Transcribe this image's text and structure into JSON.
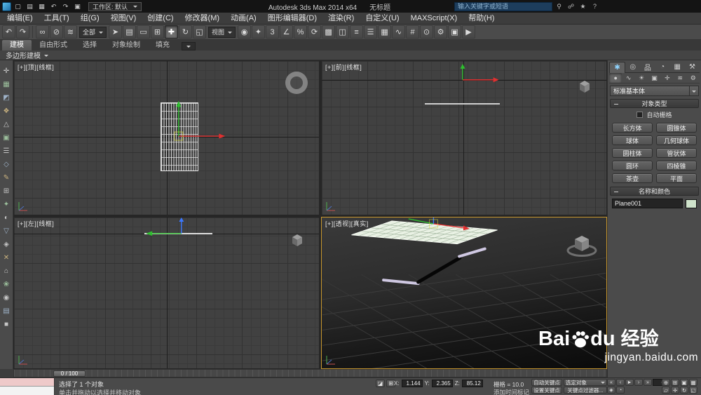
{
  "colors": {
    "active_viewport": "#c9982e",
    "object_color": "#cfe3cb"
  },
  "titlebar": {
    "icons": [
      {
        "g": "▢",
        "name": "new-scene-icon"
      },
      {
        "g": "▤",
        "name": "open-file-icon"
      },
      {
        "g": "▦",
        "name": "save-file-icon"
      },
      {
        "g": "↶",
        "name": "undo-icon"
      },
      {
        "g": "↷",
        "name": "redo-icon"
      },
      {
        "g": "▣",
        "name": "project-folder-icon"
      }
    ],
    "workspace": "工作区: 默认",
    "title": "Autodesk 3ds Max  2014 x64",
    "doc": "无标题",
    "search_placeholder": "输入关键字或短语",
    "info_icons": [
      {
        "g": "⚲",
        "name": "search-go-icon"
      },
      {
        "g": "☍",
        "name": "communication-center-icon"
      },
      {
        "g": "★",
        "name": "favorites-icon"
      },
      {
        "g": "?",
        "name": "help-icon"
      }
    ]
  },
  "menubar": {
    "items": [
      "编辑(E)",
      "工具(T)",
      "组(G)",
      "视图(V)",
      "创建(C)",
      "修改器(M)",
      "动画(A)",
      "图形编辑器(D)",
      "渲染(R)",
      "自定义(U)",
      "MAXScript(X)",
      "帮助(H)"
    ]
  },
  "toolbar": {
    "group_a": [
      {
        "g": "↶",
        "name": "undo-icon"
      },
      {
        "g": "↷",
        "name": "redo-icon"
      }
    ],
    "group_b": [
      {
        "g": "∞",
        "name": "select-and-link-icon"
      },
      {
        "g": "⊘",
        "name": "unlink-selection-icon"
      },
      {
        "g": "≋",
        "name": "bind-to-spacewarp-icon"
      }
    ],
    "filter_combo": "全部",
    "group_c": [
      {
        "g": "➤",
        "name": "select-object-icon"
      },
      {
        "g": "▤",
        "name": "select-by-name-icon"
      },
      {
        "g": "▭",
        "name": "selection-region-icon"
      },
      {
        "g": "⊞",
        "name": "window-crossing-icon"
      },
      {
        "g": "✚",
        "name": "select-and-move-icon",
        "active": true
      },
      {
        "g": "↻",
        "name": "select-and-rotate-icon"
      },
      {
        "g": "◱",
        "name": "select-and-scale-icon"
      }
    ],
    "ref_combo": "视图",
    "group_d": [
      {
        "g": "◉",
        "name": "use-pivot-center-icon"
      },
      {
        "g": "✦",
        "name": "select-and-manipulate-icon"
      },
      {
        "g": "3",
        "name": "snap-toggle-3d-icon"
      },
      {
        "g": "∠",
        "name": "angle-snap-icon"
      },
      {
        "g": "%",
        "name": "percent-snap-icon"
      },
      {
        "g": "⟳",
        "name": "spinner-snap-icon"
      },
      {
        "g": "▩",
        "name": "named-selection-sets-icon"
      },
      {
        "g": "◫",
        "name": "mirror-icon"
      },
      {
        "g": "≡",
        "name": "align-icon"
      },
      {
        "g": "☰",
        "name": "layer-manager-icon"
      },
      {
        "g": "▦",
        "name": "graphite-ribbon-icon"
      },
      {
        "g": "∿",
        "name": "curve-editor-icon"
      },
      {
        "g": "#",
        "name": "schematic-view-icon"
      },
      {
        "g": "⊙",
        "name": "material-editor-icon"
      },
      {
        "g": "⚙",
        "name": "render-setup-icon"
      },
      {
        "g": "▣",
        "name": "rendered-frame-icon"
      },
      {
        "g": "▶",
        "name": "render-production-icon"
      }
    ]
  },
  "ribbon": {
    "tabs": [
      {
        "label": "建模",
        "active": true
      },
      {
        "label": "自由形式"
      },
      {
        "label": "选择"
      },
      {
        "label": "对象绘制"
      },
      {
        "label": "填充"
      }
    ],
    "panel_label": "多边形建模"
  },
  "left_strip": {
    "icons": [
      {
        "g": "✛",
        "color": "#cccccc"
      },
      {
        "g": "▦",
        "color": "#9cbf9c"
      },
      {
        "g": "◩",
        "color": "#9fb3c9"
      },
      {
        "g": "❖",
        "color": "#c9b27f"
      },
      {
        "g": "△",
        "color": "#c6c6c6"
      },
      {
        "g": "▣",
        "color": "#9cbf9c"
      },
      {
        "g": "☰",
        "color": "#c6c6c6"
      },
      {
        "g": "◇",
        "color": "#9fb3c9"
      },
      {
        "g": "✎",
        "color": "#c9b27f"
      },
      {
        "g": "⊞",
        "color": "#c6c6c6"
      },
      {
        "g": "✦",
        "color": "#9cbf9c"
      },
      {
        "g": "◐",
        "color": "#c6c6c6"
      },
      {
        "g": "▽",
        "color": "#9fb3c9"
      },
      {
        "g": "◈",
        "color": "#c6c6c6"
      },
      {
        "g": "✕",
        "color": "#c9b27f"
      },
      {
        "g": "⌂",
        "color": "#c6c6c6"
      },
      {
        "g": "❀",
        "color": "#9cbf9c"
      },
      {
        "g": "◉",
        "color": "#c6c6c6"
      },
      {
        "g": "▤",
        "color": "#9fb3c9"
      },
      {
        "g": "■",
        "color": "#c6c6c6"
      }
    ]
  },
  "viewports": {
    "top_left": "[+][顶][线框]",
    "top_right": "[+][前][线框]",
    "bottom_left": "[+][左][线框]",
    "perspective": "[+][透视][真实]"
  },
  "command_panel": {
    "tabs": [
      {
        "g": "✱",
        "name": "tab-create",
        "active": true
      },
      {
        "g": "◎",
        "name": "tab-modify"
      },
      {
        "g": "品",
        "name": "tab-hierarchy"
      },
      {
        "g": "◔",
        "name": "tab-motion"
      },
      {
        "g": "▦",
        "name": "tab-display"
      },
      {
        "g": "⚒",
        "name": "tab-utilities"
      }
    ],
    "cats": [
      {
        "g": "●",
        "name": "cat-geometry",
        "active": true
      },
      {
        "g": "∿",
        "name": "cat-shapes"
      },
      {
        "g": "☀",
        "name": "cat-lights"
      },
      {
        "g": "▣",
        "name": "cat-cameras"
      },
      {
        "g": "✛",
        "name": "cat-helpers"
      },
      {
        "g": "≋",
        "name": "cat-spacewarps"
      },
      {
        "g": "⚙",
        "name": "cat-systems"
      }
    ],
    "dropdown": "标准基本体",
    "object_type_header": "对象类型",
    "autogrid_label": "自动栅格",
    "prims": [
      "长方体",
      "圆锥体",
      "球体",
      "几何球体",
      "圆柱体",
      "管状体",
      "圆环",
      "四棱锥",
      "茶壶",
      "平面"
    ],
    "name_color_header": "名称和颜色",
    "object_name": "Plane001"
  },
  "timeline": {
    "handle": "0 / 100"
  },
  "statusbar": {
    "selection": "选择了 1 个对象",
    "prompt": "单击并拖动以选择并移动对象",
    "locks": [
      {
        "g": "◪",
        "name": "selection-lock-icon"
      },
      {
        "g": "⊞",
        "name": "absolute-offset-mode-icon"
      }
    ],
    "x_label": "X:",
    "y_label": "Y:",
    "z_label": "Z:",
    "x": "1.144",
    "y": "2.365",
    "z": "85.12",
    "grid": "栅格 = 10.0",
    "time_tag": "添加时间标记",
    "autokey": "自动关键点",
    "sel_set": "选定对象",
    "setkey": "设置关键点",
    "key_filters": "关键点过滤器...",
    "playback": [
      {
        "g": "«",
        "name": "go-to-start-button"
      },
      {
        "g": "‹",
        "name": "prev-frame-button"
      },
      {
        "g": "►",
        "name": "play-button"
      },
      {
        "g": "›",
        "name": "next-frame-button"
      },
      {
        "g": "»",
        "name": "go-to-end-button"
      }
    ],
    "frame": "0",
    "key_icons": [
      {
        "g": "◈",
        "name": "key-mode-icon"
      },
      {
        "g": "◔",
        "name": "time-config-icon"
      }
    ],
    "nav": [
      {
        "g": "⊕",
        "name": "zoom-button"
      },
      {
        "g": "⊞",
        "name": "zoom-all-button"
      },
      {
        "g": "▣",
        "name": "zoom-extents-button"
      },
      {
        "g": "▦",
        "name": "zoom-extents-all-button"
      },
      {
        "g": "▱",
        "name": "fov-button"
      },
      {
        "g": "✛",
        "name": "pan-button"
      },
      {
        "g": "↻",
        "name": "orbit-button"
      },
      {
        "g": "◱",
        "name": "maximize-viewport-button"
      }
    ]
  },
  "watermark": {
    "pre": "Bai",
    "post": "du",
    "cn": "经验",
    "url": "jingyan.baidu.com"
  }
}
